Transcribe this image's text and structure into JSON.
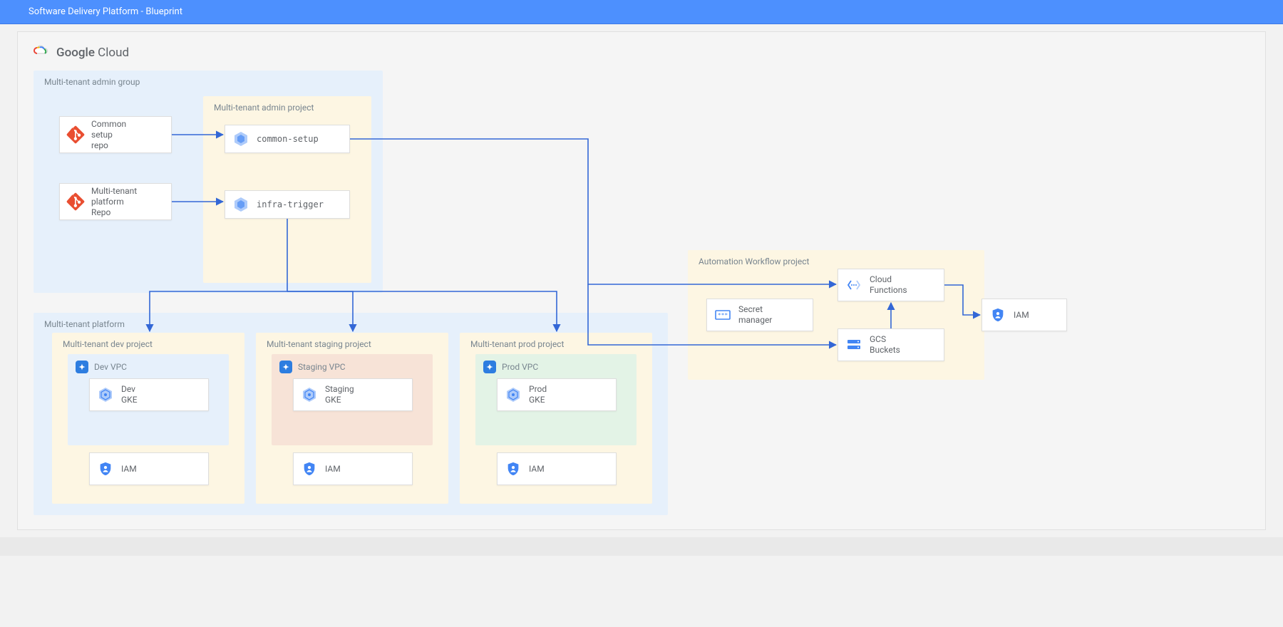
{
  "header": {
    "title": "Software Delivery Platform - Blueprint"
  },
  "brand": {
    "name_bold": "Google",
    "name_rest": "Cloud"
  },
  "groups": {
    "admin_group": {
      "title": "Multi-tenant admin group"
    },
    "admin_project": {
      "title": "Multi-tenant admin project"
    },
    "platform": {
      "title": "Multi-tenant platform"
    },
    "dev_project": {
      "title": "Multi-tenant dev project"
    },
    "staging_project": {
      "title": "Multi-tenant staging project"
    },
    "prod_project": {
      "title": "Multi-tenant prod project"
    },
    "dev_vpc": {
      "title": "Dev VPC"
    },
    "staging_vpc": {
      "title": "Staging VPC"
    },
    "prod_vpc": {
      "title": "Prod VPC"
    },
    "automation": {
      "title": "Automation Workflow project"
    }
  },
  "nodes": {
    "common_repo": "Common\nsetup\nrepo",
    "platform_repo": "Multi-tenant\nplatform\nRepo",
    "common_setup": "common-setup",
    "infra_trigger": "infra-trigger",
    "dev_gke": "Dev\nGKE",
    "staging_gke": "Staging\nGKE",
    "prod_gke": "Prod\nGKE",
    "dev_iam": "IAM",
    "staging_iam": "IAM",
    "prod_iam": "IAM",
    "secret_mgr": "Secret\nmanager",
    "cloud_fn": "Cloud\nFunctions",
    "gcs": "GCS\nBuckets",
    "main_iam": "IAM"
  },
  "colors": {
    "arrow": "#3367d6"
  }
}
